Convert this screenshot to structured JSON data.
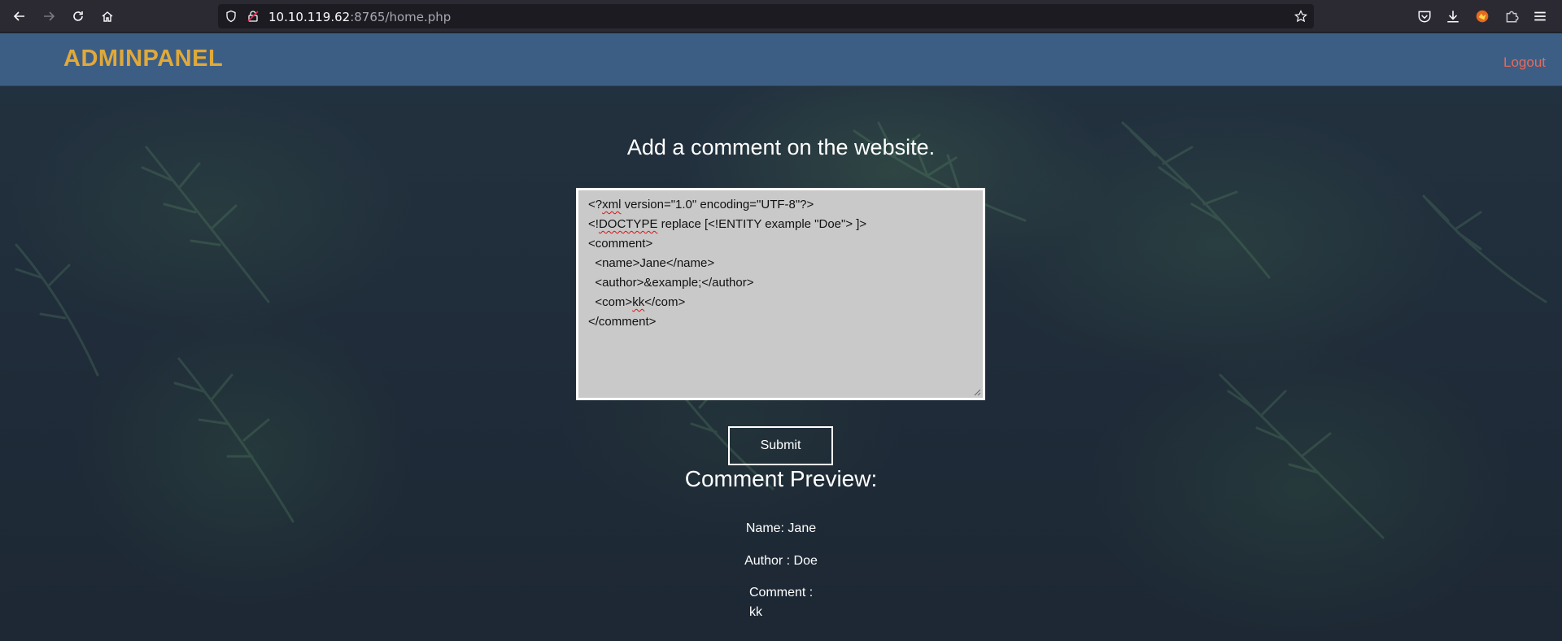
{
  "browser": {
    "url_host": "10.10.119.62",
    "url_rest": ":8765/home.php"
  },
  "site": {
    "brand": "ADMINPANEL",
    "logout_label": "Logout",
    "heading": "Add a comment on the website.",
    "editor_lines": [
      {
        "pre": "<?",
        "sq": "xml",
        "post": " version=\"1.0\" encoding=\"UTF-8\"?>"
      },
      {
        "pre": "<!",
        "sq": "DOCTYPE",
        "post": " replace [<!ENTITY example \"Doe\"> ]>"
      },
      {
        "pre": "<comment>",
        "sq": "",
        "post": ""
      },
      {
        "pre": "  <name>Jane</name>",
        "sq": "",
        "post": ""
      },
      {
        "pre": "  <author>&example;</author>",
        "sq": "",
        "post": ""
      },
      {
        "pre": "  <com>",
        "sq": "kk",
        "post": "</com>"
      },
      {
        "pre": "</comment>",
        "sq": "",
        "post": ""
      }
    ],
    "submit_label": "Submit",
    "preview_title": "Comment Preview:",
    "preview_name": "Name: Jane",
    "preview_author": "Author : Doe",
    "preview_comment_label": "Comment :",
    "preview_comment_value": "kk"
  },
  "colors": {
    "brand": "#e0a93a",
    "logout": "#e8695a",
    "topbar": "#3d5e84"
  }
}
